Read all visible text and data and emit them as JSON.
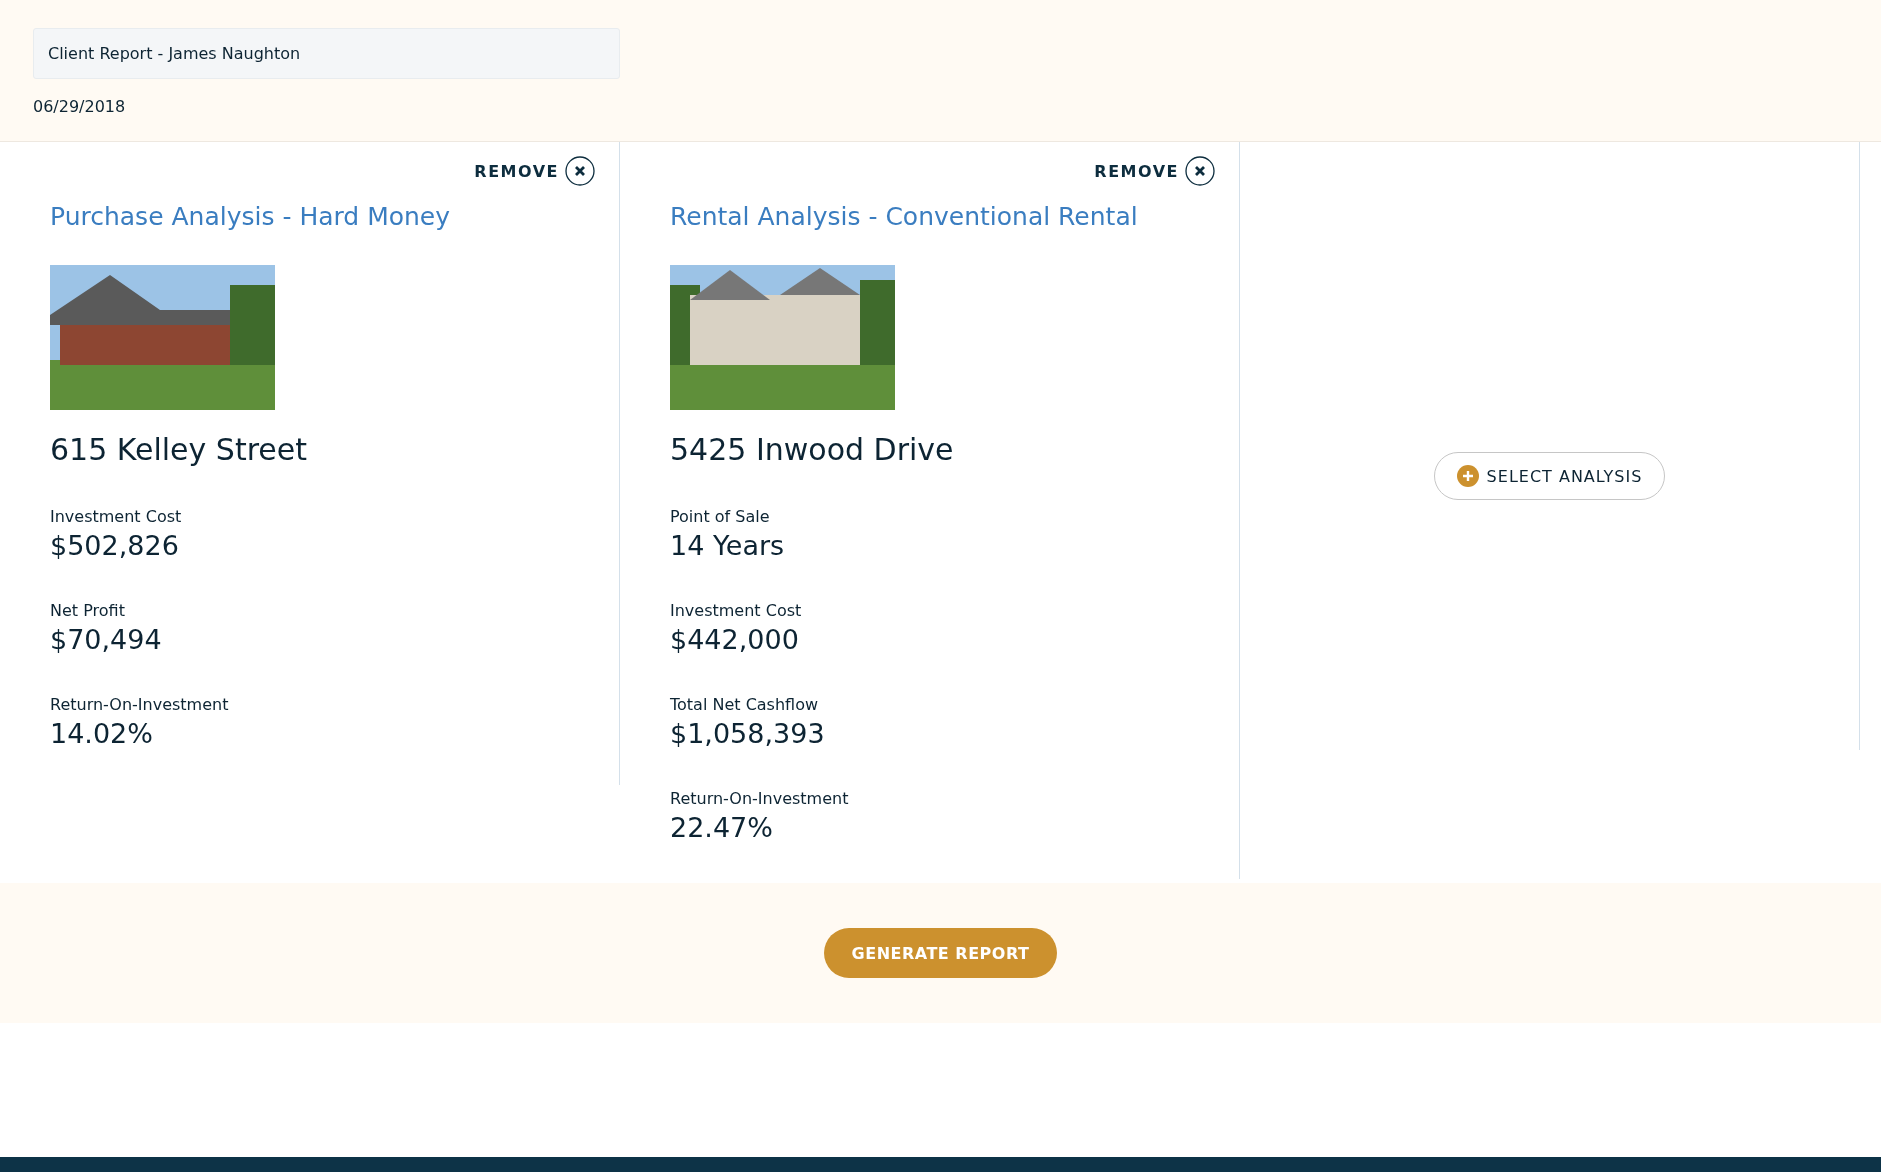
{
  "report": {
    "title": "Client Report - James Naughton",
    "date": "06/29/2018"
  },
  "analyses": [
    {
      "remove_label": "REMOVE",
      "title": "Purchase Analysis - Hard Money",
      "address": "615 Kelley Street",
      "metrics": [
        {
          "label": "Investment Cost",
          "value": "$502,826"
        },
        {
          "label": "Net Profit",
          "value": "$70,494"
        },
        {
          "label": "Return-On-Investment",
          "value": "14.02%"
        }
      ]
    },
    {
      "remove_label": "REMOVE",
      "title": "Rental Analysis - Conventional Rental",
      "address": "5425 Inwood Drive",
      "metrics": [
        {
          "label": "Point of Sale",
          "value": "14 Years"
        },
        {
          "label": "Investment Cost",
          "value": "$442,000"
        },
        {
          "label": "Total Net Cashflow",
          "value": "$1,058,393"
        },
        {
          "label": "Return-On-Investment",
          "value": "22.47%"
        }
      ]
    }
  ],
  "select_button": "SELECT ANALYSIS",
  "generate_button": "GENERATE REPORT"
}
